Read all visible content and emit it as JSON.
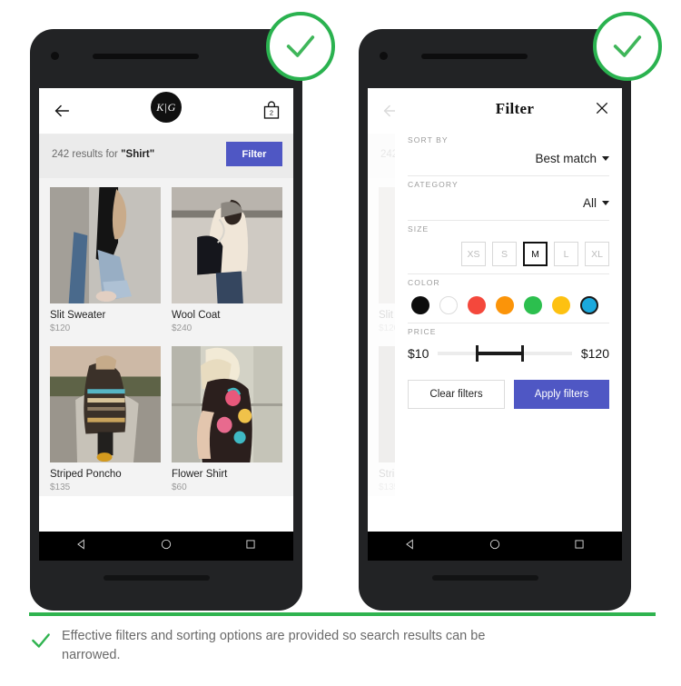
{
  "phones": {
    "left": {
      "appbar": {
        "back_icon": "arrow-left-icon",
        "logo_text": "K|G",
        "bag_icon": "shopping-bag-icon",
        "bag_count": "2"
      },
      "results": {
        "count_prefix": "242 results for ",
        "query": "\"Shirt\"",
        "filter_button": "Filter"
      },
      "products": [
        {
          "title": "Slit Sweater",
          "price": "$120",
          "image": "woman-black-cardigan-jeans"
        },
        {
          "title": "Wool Coat",
          "price": "$240",
          "image": "woman-cream-coat-black-bag"
        },
        {
          "title": "Striped Poncho",
          "price": "$135",
          "image": "woman-striped-poncho-road"
        },
        {
          "title": "Flower Shirt",
          "price": "$60",
          "image": "woman-floral-kimono"
        }
      ],
      "navbar": [
        "back-triangle-icon",
        "home-circle-icon",
        "recents-square-icon"
      ]
    },
    "right": {
      "filter": {
        "title": "Filter",
        "close_icon": "close-icon",
        "sort_by": {
          "label": "SORT BY",
          "value": "Best match"
        },
        "category": {
          "label": "CATEGORY",
          "value": "All"
        },
        "size": {
          "label": "SIZE",
          "options": [
            "XS",
            "S",
            "M",
            "L",
            "XL"
          ],
          "selected": "M"
        },
        "color": {
          "label": "COLOR",
          "swatches": [
            {
              "name": "black",
              "hex": "#0d0d0d",
              "selected": false
            },
            {
              "name": "white",
              "hex": "#ffffff",
              "selected": false
            },
            {
              "name": "red",
              "hex": "#f4483c",
              "selected": false
            },
            {
              "name": "orange",
              "hex": "#fb9409",
              "selected": false
            },
            {
              "name": "green",
              "hex": "#2cbf4e",
              "selected": false
            },
            {
              "name": "yellow",
              "hex": "#fdc111",
              "selected": false
            },
            {
              "name": "blue",
              "hex": "#1ba9dd",
              "selected": true
            }
          ]
        },
        "price": {
          "label": "PRICE",
          "min": "$10",
          "max": "$120"
        },
        "actions": {
          "clear": "Clear filters",
          "apply": "Apply filters"
        }
      },
      "navbar": [
        "back-triangle-icon",
        "home-circle-icon",
        "recents-square-icon"
      ]
    }
  },
  "badges": {
    "icon": "check-icon",
    "accent": "#2ab24f"
  },
  "footer": {
    "icon": "check-icon",
    "text": "Effective filters and sorting options are provided so search results can be narrowed.",
    "accent": "#2fb34f"
  }
}
